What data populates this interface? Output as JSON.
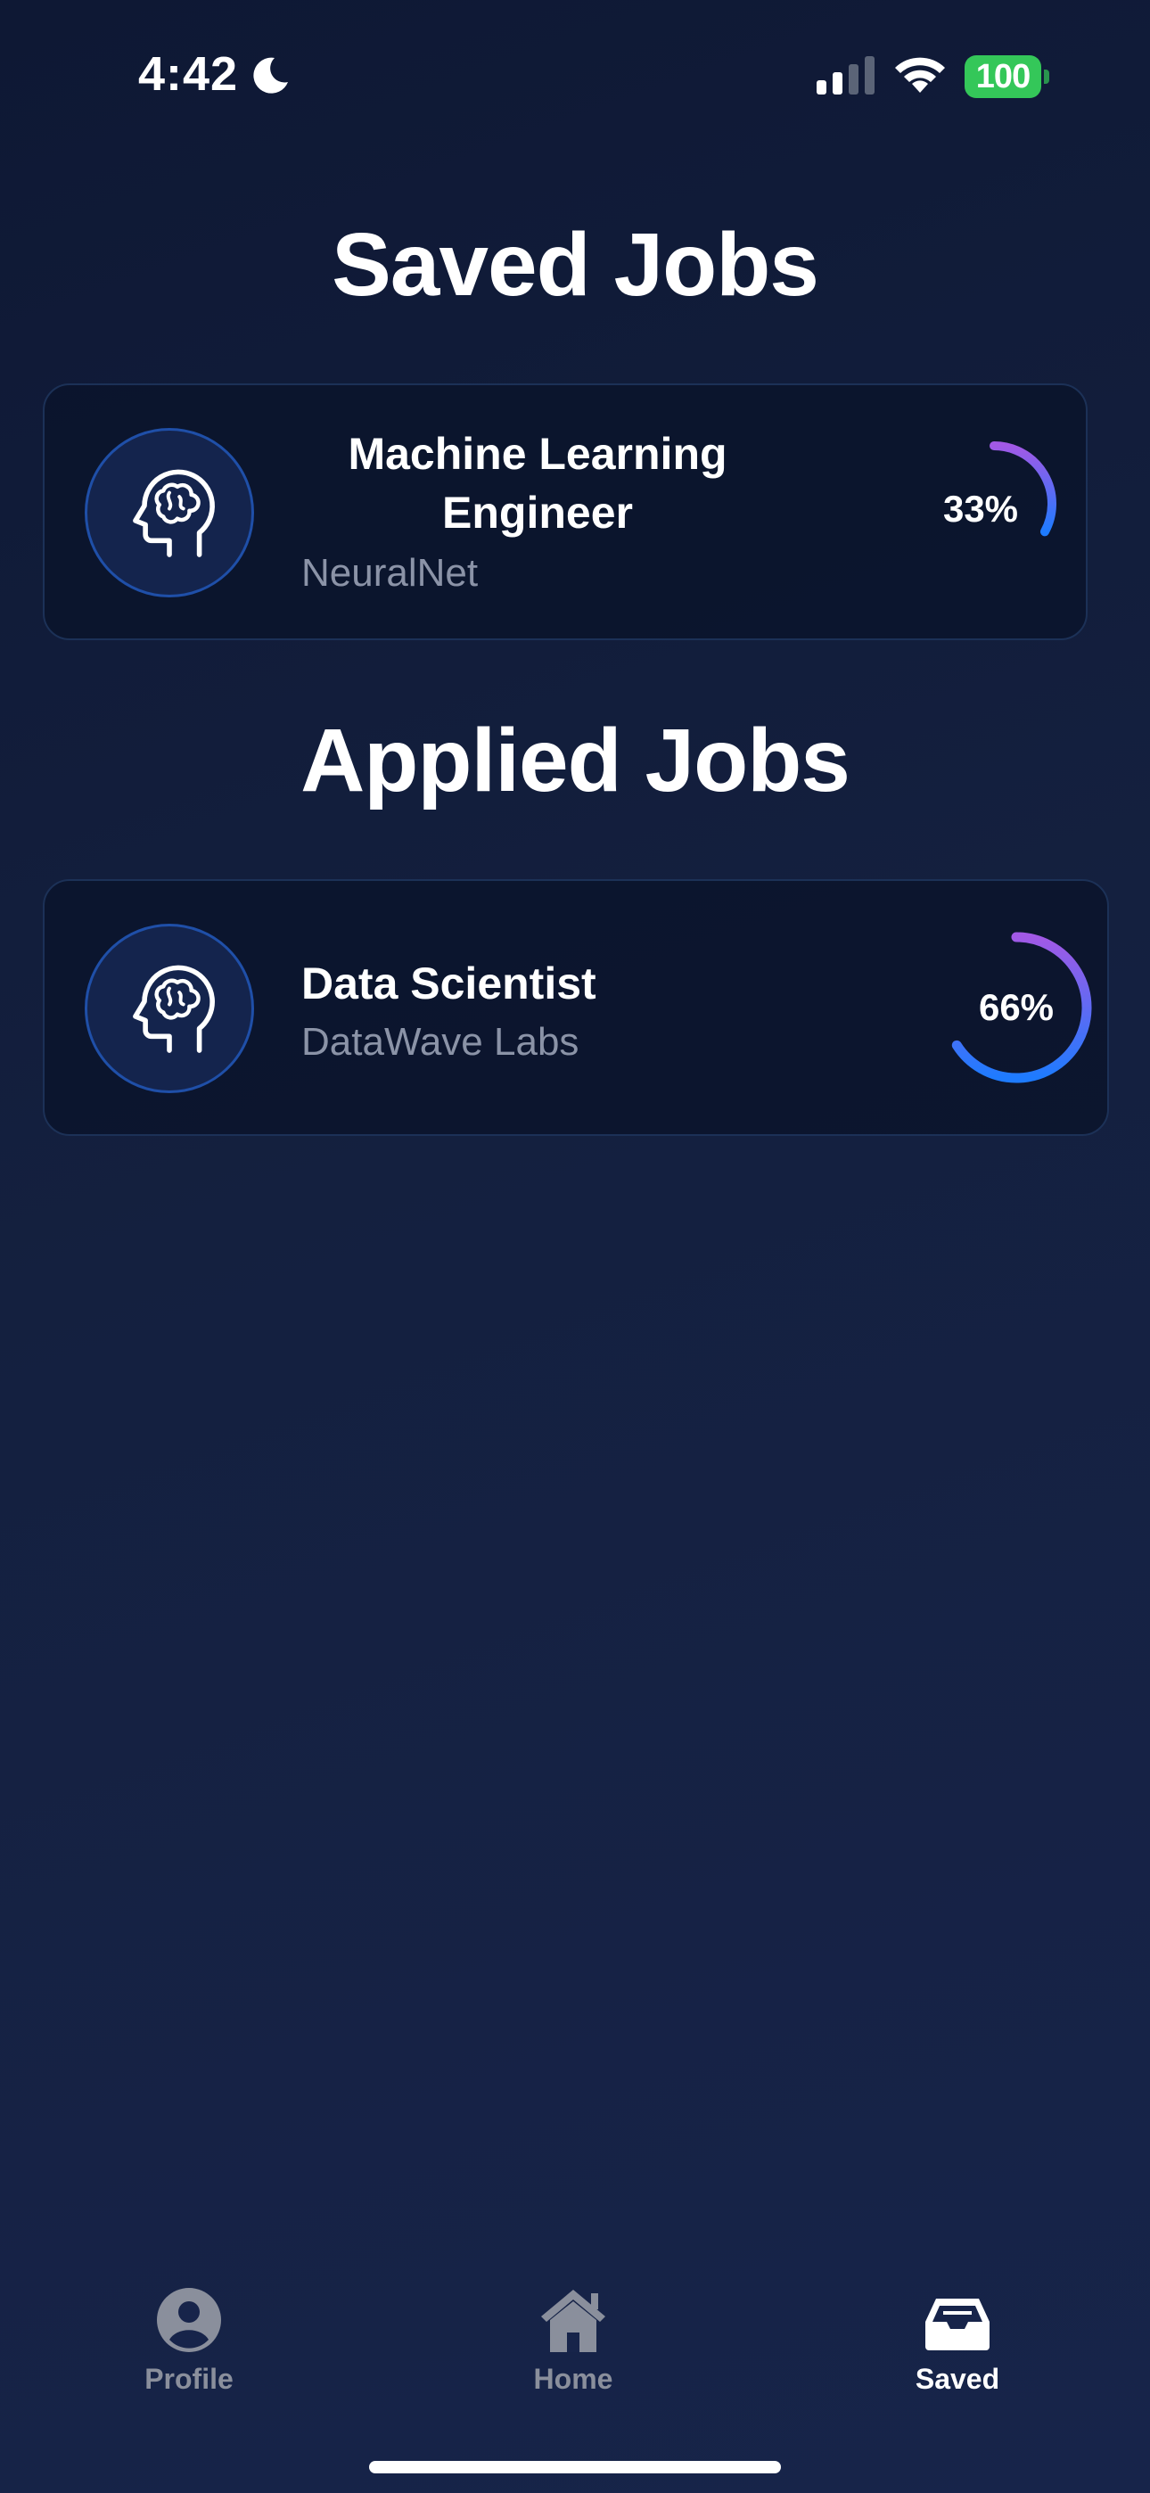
{
  "status_bar": {
    "time": "4:42",
    "battery": "100",
    "battery_color": "#34c759"
  },
  "saved_section": {
    "title": "Saved Jobs",
    "jobs": [
      {
        "title_line1": "Machine Learning",
        "title_line2": "Engineer",
        "company": "NeuralNet",
        "match_percent": 33,
        "match_label": "33%",
        "icon": "brain-head-icon"
      }
    ]
  },
  "applied_section": {
    "title": "Applied Jobs",
    "jobs": [
      {
        "title": "Data Scientist",
        "company": "DataWave Labs",
        "match_percent": 66,
        "match_label": "66%",
        "icon": "brain-head-icon"
      }
    ]
  },
  "tab_bar": {
    "items": [
      {
        "label": "Profile",
        "icon": "profile-icon",
        "active": false
      },
      {
        "label": "Home",
        "icon": "home-icon",
        "active": false
      },
      {
        "label": "Saved",
        "icon": "inbox-tray-icon",
        "active": true
      }
    ]
  },
  "colors": {
    "ring_start": "#a259e6",
    "ring_end": "#1e7bff",
    "inactive_tab": "#8a8f9c",
    "active_tab": "#ffffff"
  }
}
